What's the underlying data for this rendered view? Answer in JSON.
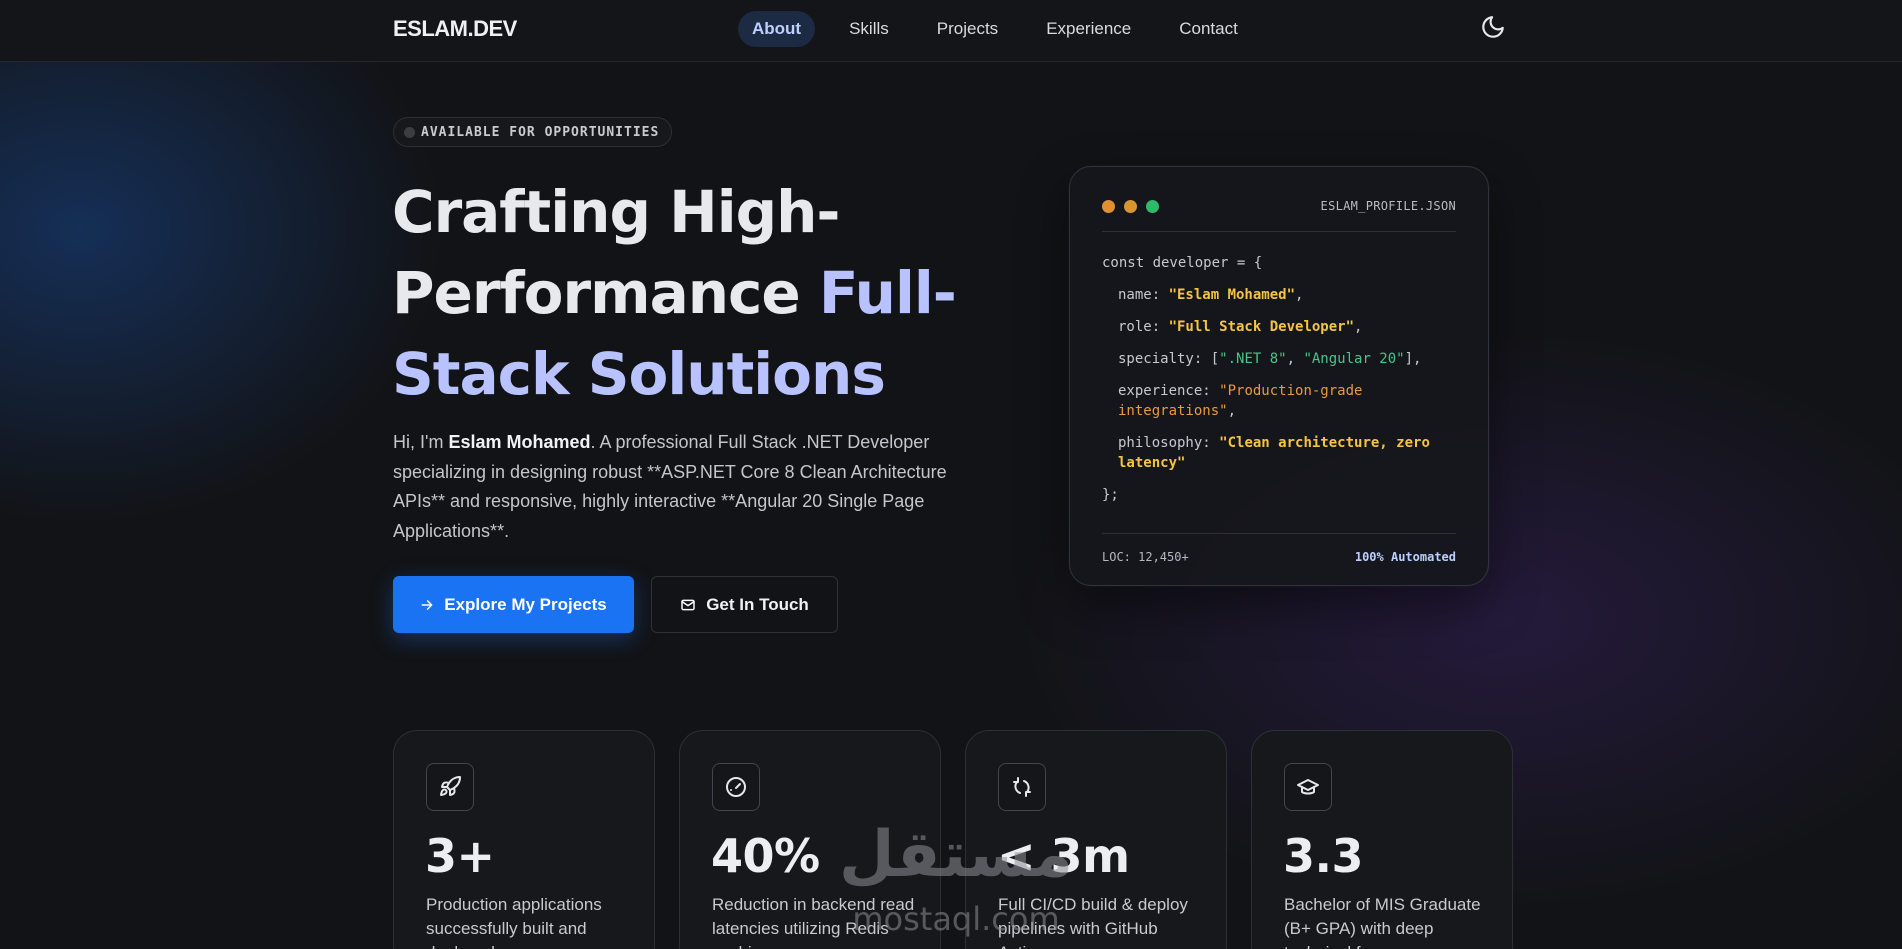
{
  "nav": {
    "logo": "ESLAM.DEV",
    "links": [
      "About",
      "Skills",
      "Projects",
      "Experience",
      "Contact"
    ],
    "active": "About",
    "theme_icon": "moon-icon"
  },
  "hero": {
    "badge": "AVAILABLE FOR OPPORTUNITIES",
    "title_plain": "Crafting High-Performance ",
    "title_accent": "Full-Stack Solutions",
    "desc_intro": "Hi, I'm ",
    "desc_name": "Eslam Mohamed",
    "desc_rest": ". A professional Full Stack .NET Developer specializing in designing robust **ASP.NET Core 8 Clean Architecture APIs** and responsive, highly interactive **Angular 20 Single Page Applications**.",
    "primary_button": "Explore My Projects",
    "primary_icon": "arrow-right-icon",
    "secondary_button": "Get In Touch",
    "secondary_icon": "mail-icon"
  },
  "code_card": {
    "file_name": "ESLAM_PROFILE.JSON",
    "dot_colors": [
      "#e0912f",
      "#d9962e",
      "#2fba6a"
    ],
    "open": "const developer = {",
    "fields": {
      "name_key": "name",
      "name_value": "\"Eslam Mohamed\"",
      "role_key": "role",
      "role_value": "\"Full Stack Developer\"",
      "specialty_key": "specialty",
      "specialty_values": [
        "\".NET 8\"",
        "\"Angular 20\""
      ],
      "experience_key": "experience",
      "experience_value": "\"Production-grade integrations\"",
      "philosophy_key": "philosophy",
      "philosophy_value": "\"Clean architecture, zero latency\""
    },
    "close": "};",
    "footer_left": "LOC: 12,450+",
    "footer_right": "100% Automated"
  },
  "stats": [
    {
      "icon": "rocket-icon",
      "value": "3+",
      "desc": "Production applications successfully built and deployed"
    },
    {
      "icon": "speedometer-icon",
      "value": "40%",
      "desc": "Reduction in backend read latencies utilizing Redis caching"
    },
    {
      "icon": "refresh-icon",
      "value": "< 3m",
      "desc": "Full CI/CD build & deploy pipelines with GitHub Actions"
    },
    {
      "icon": "graduation-cap-icon",
      "value": "3.3",
      "desc": "Bachelor of MIS Graduate (B+ GPA) with deep technical focus"
    }
  ],
  "watermark": {
    "arabic": "مستقل",
    "latin": "mostaql.com"
  },
  "colors": {
    "accent": "#1a73f2",
    "accent_text": "#b7c2ff",
    "background": "#121316"
  }
}
